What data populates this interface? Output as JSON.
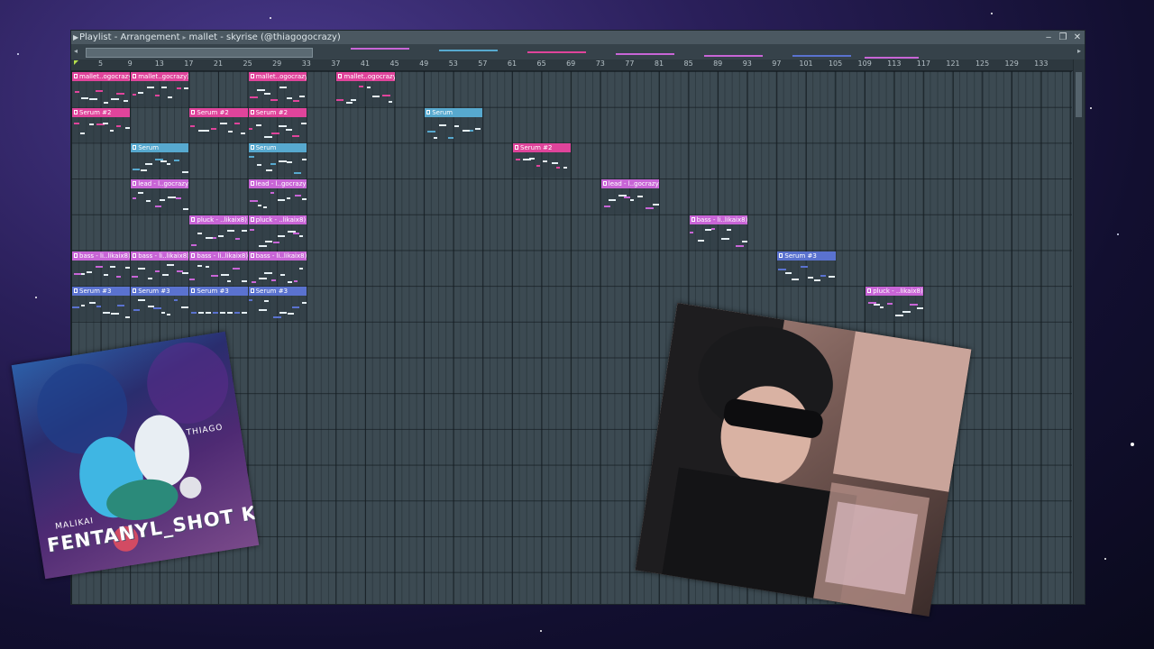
{
  "window": {
    "title_parts": [
      "Playlist - Arrangement",
      "mallet - skyrise (@thiagogocrazy)"
    ],
    "controls": {
      "minimize": "‒",
      "restore": "❐",
      "close": "✕"
    }
  },
  "ruler": {
    "bars": [
      "5",
      "9",
      "13",
      "17",
      "21",
      "25",
      "29",
      "33",
      "37",
      "41",
      "45",
      "49",
      "53",
      "57",
      "61",
      "65",
      "69",
      "73",
      "77",
      "81",
      "85",
      "89",
      "93",
      "97",
      "101",
      "105",
      "109",
      "113",
      "117",
      "121",
      "125",
      "129",
      "133"
    ]
  },
  "colors": {
    "pink": "#e0449b",
    "blue": "#57a9cf",
    "purple": "#c865d6",
    "indigo": "#5a72cf",
    "note_light": "#e6f0f5"
  },
  "clips": [
    {
      "label": "mallet..ogocrazy)",
      "color": "pink",
      "bar": 1,
      "row": 0
    },
    {
      "label": "mallet..gocrazy)",
      "color": "pink",
      "bar": 9,
      "row": 0
    },
    {
      "label": "mallet..ogocrazy)",
      "color": "pink",
      "bar": 25,
      "row": 0
    },
    {
      "label": "mallet..ogocrazy)",
      "color": "pink",
      "bar": 37,
      "row": 0
    },
    {
      "label": "Serum #2",
      "color": "pink",
      "bar": 1,
      "row": 1
    },
    {
      "label": "Serum #2",
      "color": "pink",
      "bar": 17,
      "row": 1
    },
    {
      "label": "Serum #2",
      "color": "pink",
      "bar": 25,
      "row": 1
    },
    {
      "label": "Serum",
      "color": "blue",
      "bar": 49,
      "row": 1
    },
    {
      "label": "Serum",
      "color": "blue",
      "bar": 9,
      "row": 2
    },
    {
      "label": "Serum",
      "color": "blue",
      "bar": 25,
      "row": 2
    },
    {
      "label": "Serum #2",
      "color": "pink",
      "bar": 61,
      "row": 2
    },
    {
      "label": "lead - l..gocrazy)",
      "color": "purple",
      "bar": 9,
      "row": 3
    },
    {
      "label": "lead - l..gocrazy)",
      "color": "purple",
      "bar": 25,
      "row": 3
    },
    {
      "label": "lead - l..gocrazy)",
      "color": "purple",
      "bar": 73,
      "row": 3
    },
    {
      "label": "pluck - ..likaix8)",
      "color": "purple",
      "bar": 17,
      "row": 4
    },
    {
      "label": "pluck - ..likaix8)",
      "color": "purple",
      "bar": 25,
      "row": 4
    },
    {
      "label": "bass - li..likaix8)",
      "color": "purple",
      "bar": 85,
      "row": 4
    },
    {
      "label": "bass - li..likaix8)",
      "color": "purple",
      "bar": 1,
      "row": 5
    },
    {
      "label": "bass - li..likaix8)",
      "color": "purple",
      "bar": 9,
      "row": 5
    },
    {
      "label": "bass - li..likaix8)",
      "color": "purple",
      "bar": 17,
      "row": 5
    },
    {
      "label": "bass - li..likaix8)",
      "color": "purple",
      "bar": 25,
      "row": 5
    },
    {
      "label": "Serum #3",
      "color": "indigo",
      "bar": 97,
      "row": 5
    },
    {
      "label": "Serum #3",
      "color": "indigo",
      "bar": 1,
      "row": 6
    },
    {
      "label": "Serum #3",
      "color": "indigo",
      "bar": 9,
      "row": 6
    },
    {
      "label": "Serum #3",
      "color": "indigo",
      "bar": 17,
      "row": 6
    },
    {
      "label": "Serum #3",
      "color": "indigo",
      "bar": 25,
      "row": 6
    },
    {
      "label": "pluck - ..likaix8)",
      "color": "purple",
      "bar": 109,
      "row": 6
    }
  ],
  "cover_art": {
    "title": "FENTANYL_SHOT KIT",
    "label_left": "MALIKAI",
    "label_right": "THIAGO"
  }
}
